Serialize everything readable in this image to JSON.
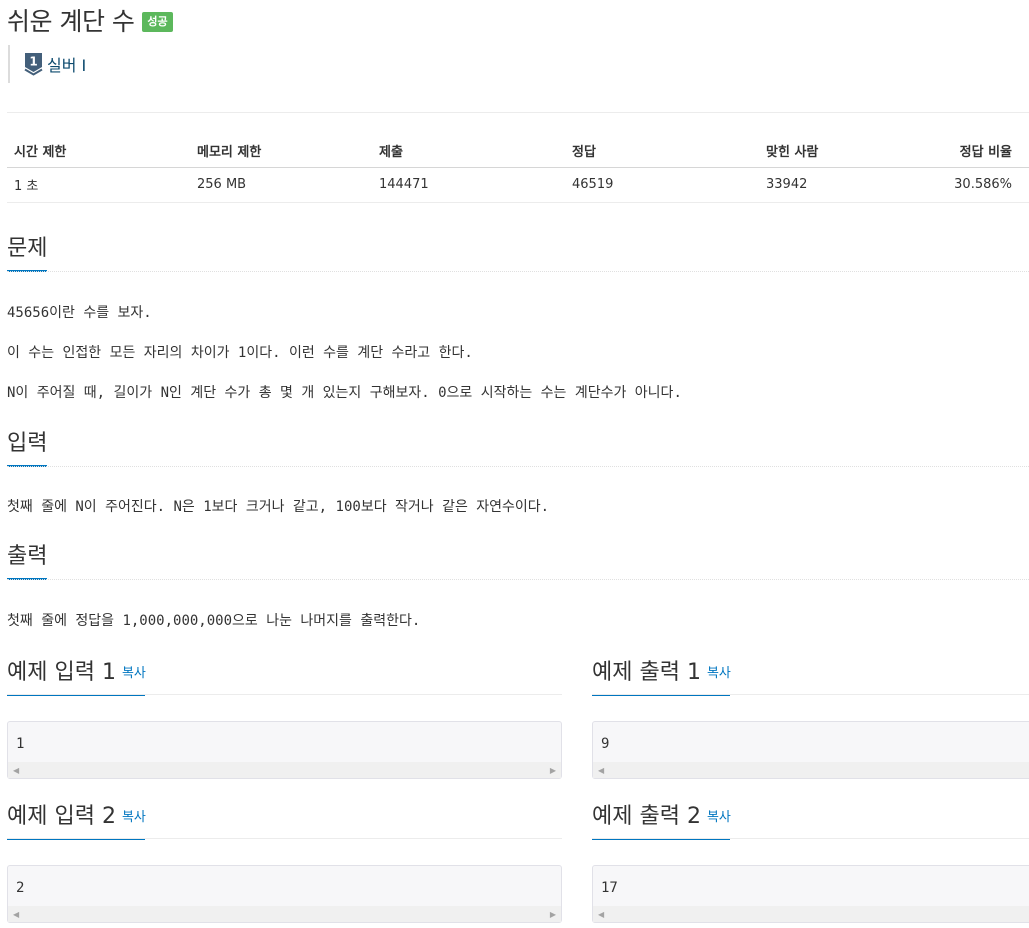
{
  "problem": {
    "title": "쉬운 계단 수",
    "status_badge": "성공",
    "tier_number": "1",
    "tier_label": "실버 I"
  },
  "info_table": {
    "headers": [
      "시간 제한",
      "메모리 제한",
      "제출",
      "정답",
      "맞힌 사람",
      "정답 비율"
    ],
    "values": [
      "1 초",
      "256 MB",
      "144471",
      "46519",
      "33942",
      "30.586%"
    ]
  },
  "sections": {
    "description": {
      "heading": "문제",
      "lines": [
        "45656이란 수를 보자.",
        "이 수는 인접한 모든 자리의 차이가 1이다. 이런 수를 계단 수라고 한다.",
        "N이 주어질 때, 길이가 N인 계단 수가 총 몇 개 있는지 구해보자. 0으로 시작하는 수는 계단수가 아니다."
      ]
    },
    "input": {
      "heading": "입력",
      "text": "첫째 줄에 N이 주어진다. N은 1보다 크거나 같고, 100보다 작거나 같은 자연수이다."
    },
    "output": {
      "heading": "출력",
      "text": "첫째 줄에 정답을 1,000,000,000으로 나눈 나머지를 출력한다."
    }
  },
  "examples": [
    {
      "input_title": "예제 입력 1",
      "output_title": "예제 출력 1",
      "input": "1",
      "output": "9"
    },
    {
      "input_title": "예제 입력 2",
      "output_title": "예제 출력 2",
      "input": "2",
      "output": "17"
    }
  ],
  "copy_label": "복사",
  "colors": {
    "success_badge": "#5cb85c",
    "accent_blue": "#0076c0",
    "tier_silver": "#435f7a"
  }
}
